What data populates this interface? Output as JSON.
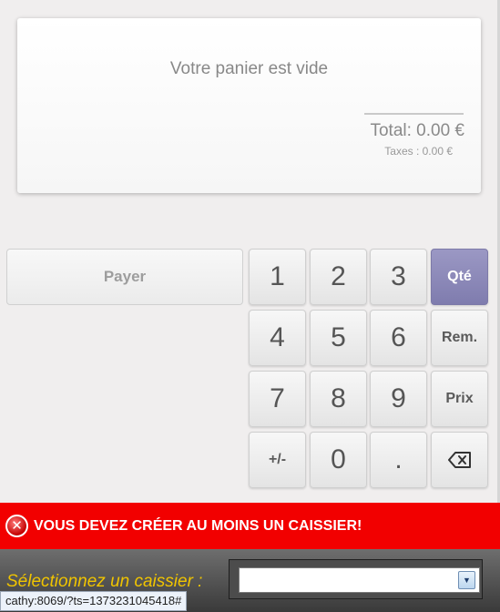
{
  "cart": {
    "empty_message": "Votre panier est vide",
    "total": "Total: 0.00 €",
    "taxes": "Taxes : 0.00 €"
  },
  "actions": {
    "pay_label": "Payer"
  },
  "numpad": {
    "keys": [
      "1",
      "2",
      "3",
      "4",
      "5",
      "6",
      "7",
      "8",
      "9",
      "+/-",
      "0",
      "."
    ],
    "mode_qty": "Qté",
    "mode_discount": "Rem.",
    "mode_price": "Prix",
    "backspace_icon": "backspace-icon"
  },
  "error": {
    "message": "VOUS DEVEZ CRÉER AU MOINS UN CAISSIER!",
    "icon": "error-x-icon"
  },
  "cashier": {
    "label": "Sélectionnez un caissier :",
    "selected": ""
  },
  "status": {
    "url": "cathy:8069/?ts=1373231045418#"
  },
  "colors": {
    "accent": "#8886b8",
    "error": "#f20000",
    "label_yellow": "#f0c400"
  }
}
